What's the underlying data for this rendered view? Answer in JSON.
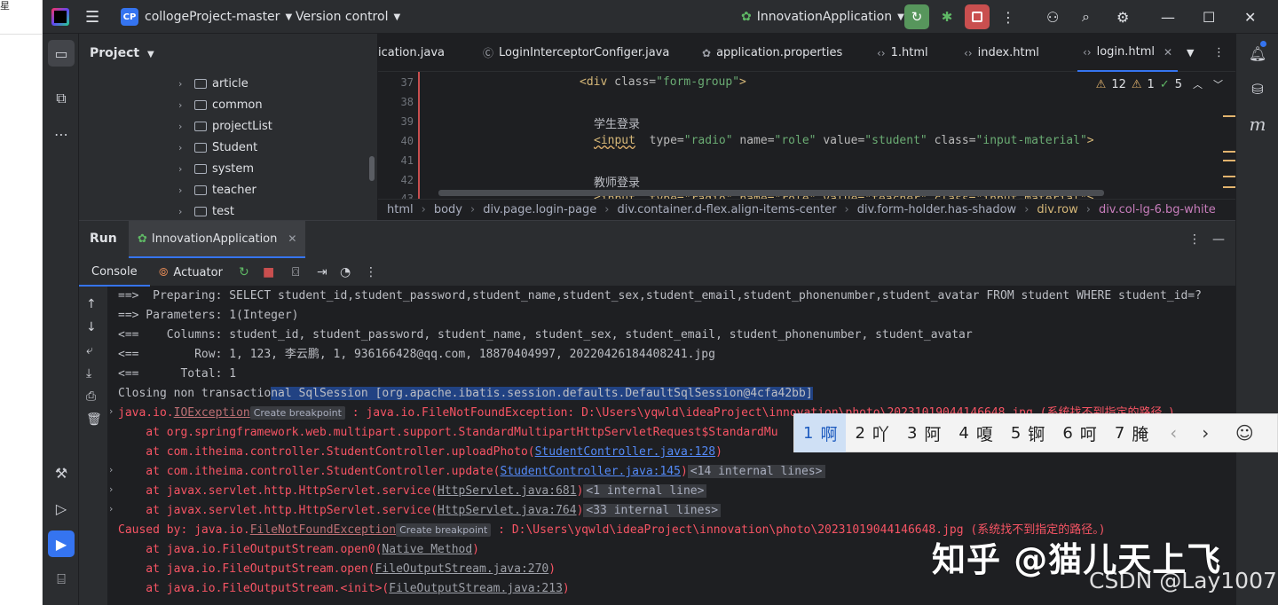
{
  "left_strip": {
    "fragment": "星"
  },
  "titlebar": {
    "project_badge": "CP",
    "project_name": "collogeProject-master",
    "vcs_label": "Version control",
    "run_config": "InnovationApplication"
  },
  "project_panel": {
    "title": "Project",
    "items": [
      "article",
      "common",
      "projectList",
      "Student",
      "system",
      "teacher",
      "test"
    ]
  },
  "editor": {
    "tabs": [
      "ication.java",
      "LoginInterceptorConfiger.java",
      "application.properties",
      "1.html",
      "index.html",
      "login.html"
    ],
    "inspection": {
      "warnings": "12",
      "weak_warnings": "1",
      "ok": "5"
    },
    "line_numbers": [
      "37",
      "38",
      "39",
      "40",
      "41",
      "42",
      "43"
    ],
    "lines": {
      "l37": {
        "tag_open": "<div ",
        "attr": "class=",
        "val": "\"form-group\"",
        "tag_close": ">"
      },
      "l39": "学生登录",
      "l40": {
        "tag": "<input",
        "rest_attr1": "  type=",
        "v1": "\"radio\"",
        "a2": " name=",
        "v2": "\"role\"",
        "a3": " value=",
        "v3": "\"student\"",
        "a4": " class=",
        "v4": "\"input-material\"",
        "end": ">"
      },
      "l42": "教师登录",
      "l43": "<input  type=\"radio\" name=\"role\" value=\"teacher\" class=\"input-material\">"
    },
    "breadcrumb": [
      "html",
      "body",
      "div.page.login-page",
      "div.container.d-flex.align-items-center",
      "div.form-holder.has-shadow",
      "div.row",
      "div.col-lg-6.bg-white"
    ]
  },
  "run_panel": {
    "title": "Run",
    "tab_label": "InnovationApplication",
    "console_tab": "Console",
    "actuator_tab": "Actuator",
    "console_lines": {
      "l1": "==>  Preparing: SELECT student_id,student_password,student_name,student_sex,student_email,student_phonenumber,student_avatar FROM student WHERE student_id=?",
      "l2": "==> Parameters: 1(Integer)",
      "l3": "<==    Columns: student_id, student_password, student_name, student_sex, student_email, student_phonenumber, student_avatar",
      "l4": "<==        Row: 1, 123, 李云鹏, 1, 936166428@qq.com, 18870404997, 20220426184408241.jpg",
      "l5": "<==      Total: 1",
      "l6a": "Closing non transactio",
      "l6b": "nal SqlSession [org.apache.ibatis.session.defaults.DefaultSqlSession@4cfa42bb]",
      "l7a": "java.io.",
      "l7link": "IOException",
      "l7hint": "Create breakpoint",
      "l7b": " : java.io.FileNotFoundException: D:\\Users\\yqwld\\ideaProject\\innovation\\photo\\20231019044146648.jpg (系统找不到指定的路径。)",
      "l8": "    at org.springframework.web.multipart.support.StandardMultipartHttpServletRequest$StandardMu",
      "l9a": "    at com.itheima.controller.StudentController.uploadPhoto(",
      "l9link": "StudentController.java:128",
      "l9b": ")",
      "l10a": "    at com.itheima.controller.StudentController.update(",
      "l10link": "StudentController.java:145",
      "l10b": ")",
      "l10fold": "<14 internal lines>",
      "l11a": "    at javax.servlet.http.HttpServlet.service(",
      "l11link": "HttpServlet.java:681",
      "l11b": ")",
      "l11fold": "<1 internal line>",
      "l12a": "    at javax.servlet.http.HttpServlet.service(",
      "l12link": "HttpServlet.java:764",
      "l12b": ")",
      "l12fold": "<33 internal lines>",
      "l13a": "Caused by: java.io.",
      "l13link": "FileNotFoundException",
      "l13hint": "Create breakpoint",
      "l13b": " : D:\\Users\\yqwld\\ideaProject\\innovation\\photo\\20231019044146648.jpg (系统找不到指定的路径。)",
      "l14a": "    at java.io.FileOutputStream.open0(",
      "l14link": "Native Method",
      "l14b": ")",
      "l15a": "    at java.io.FileOutputStream.open(",
      "l15link": "FileOutputStream.java:270",
      "l15b": ")",
      "l16a": "    at java.io.FileOutputStream.<init>(",
      "l16link": "FileOutputStream.java:213",
      "l16b": ")"
    }
  },
  "ime": {
    "candidates": [
      {
        "num": "1",
        "text": "啊"
      },
      {
        "num": "2",
        "text": "吖"
      },
      {
        "num": "3",
        "text": "阿"
      },
      {
        "num": "4",
        "text": "嗄"
      },
      {
        "num": "5",
        "text": "锕"
      },
      {
        "num": "6",
        "text": "呵"
      },
      {
        "num": "7",
        "text": "腌"
      }
    ],
    "prev": "‹",
    "next": "›",
    "emoji": "☺"
  },
  "watermark": {
    "zhihu": "知乎 @猫儿天上飞",
    "csdn": "CSDN @Lay1007"
  },
  "colors": {
    "accent": "#3574f0",
    "error": "#f75464",
    "link": "#548af7",
    "run_green": "#57965c",
    "stop_red": "#c94f4f"
  }
}
